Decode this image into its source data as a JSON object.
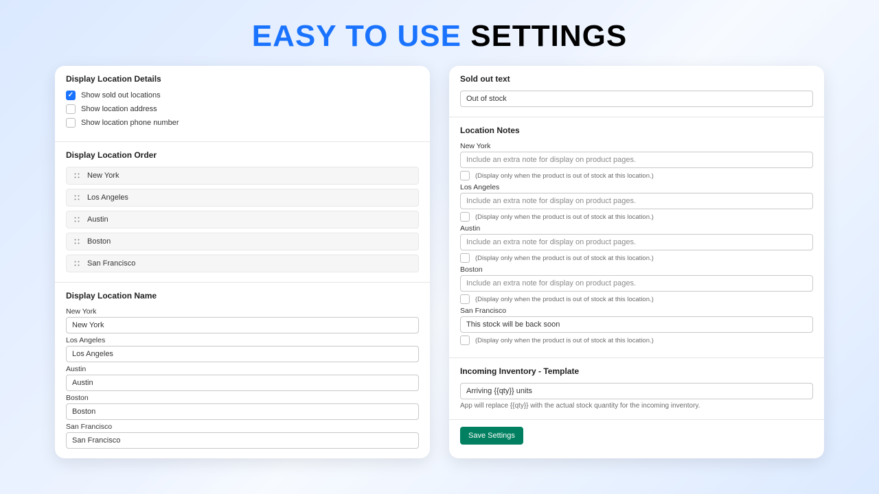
{
  "headline": {
    "part1": "EASY TO USE",
    "part2": "SETTINGS"
  },
  "left": {
    "details": {
      "title": "Display Location Details",
      "options": [
        {
          "label": "Show sold out locations",
          "checked": true
        },
        {
          "label": "Show location address",
          "checked": false
        },
        {
          "label": "Show location phone number",
          "checked": false
        }
      ]
    },
    "order": {
      "title": "Display Location Order",
      "items": [
        "New York",
        "Los Angeles",
        "Austin",
        "Boston",
        "San Francisco"
      ]
    },
    "names": {
      "title": "Display Location Name",
      "items": [
        {
          "label": "New York",
          "value": "New York"
        },
        {
          "label": "Los Angeles",
          "value": "Los Angeles"
        },
        {
          "label": "Austin",
          "value": "Austin"
        },
        {
          "label": "Boston",
          "value": "Boston"
        },
        {
          "label": "San Francisco",
          "value": "San Francisco"
        }
      ]
    }
  },
  "right": {
    "soldOut": {
      "title": "Sold out text",
      "value": "Out of stock"
    },
    "notes": {
      "title": "Location Notes",
      "placeholder": "Include an extra note for display on product pages.",
      "subLabel": "(Display only when the product is out of stock at this location.)",
      "items": [
        {
          "label": "New York",
          "value": ""
        },
        {
          "label": "Los Angeles",
          "value": ""
        },
        {
          "label": "Austin",
          "value": ""
        },
        {
          "label": "Boston",
          "value": ""
        },
        {
          "label": "San Francisco",
          "value": "This stock will be back soon"
        }
      ]
    },
    "incoming": {
      "title": "Incoming Inventory - Template",
      "value": "Arriving {{qty}} units",
      "hint": "App will replace {{qty}} with the actual stock quantity for the incoming inventory."
    },
    "saveLabel": "Save Settings"
  }
}
